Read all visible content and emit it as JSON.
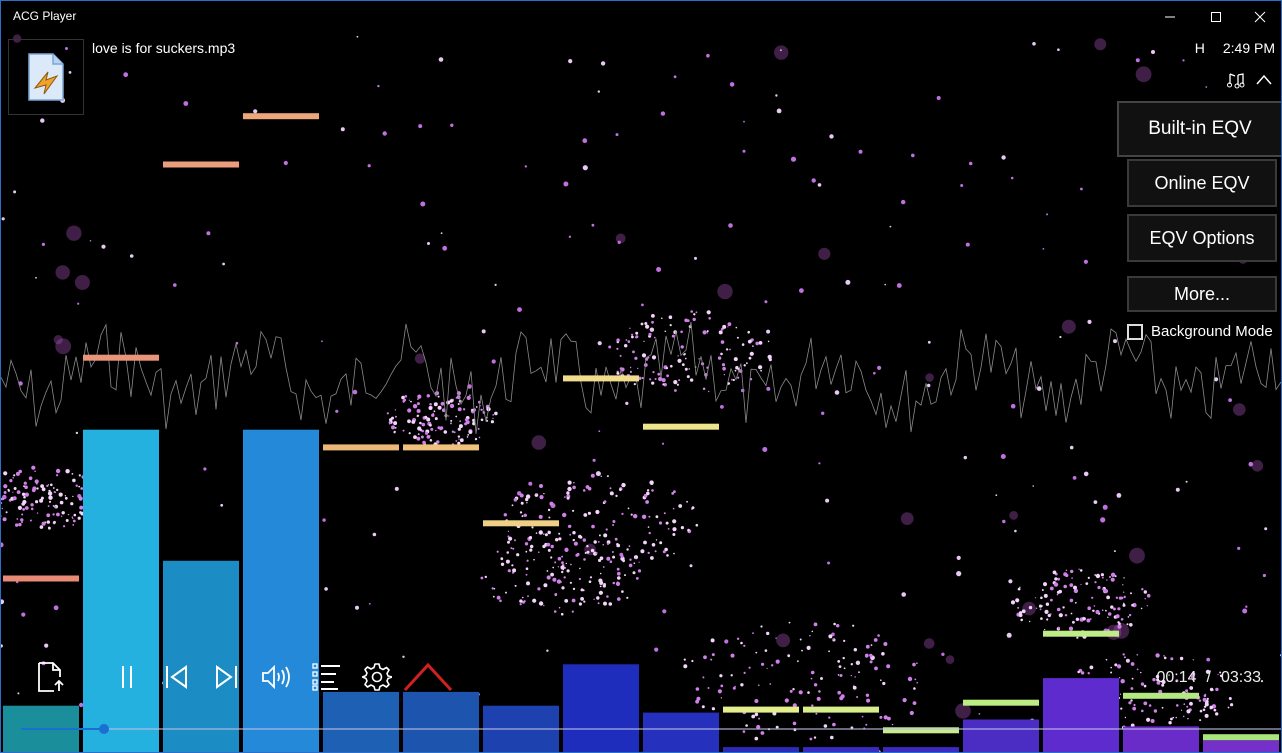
{
  "window": {
    "title": "ACG Player",
    "minimize_label": "Minimize",
    "maximize_label": "Maximize",
    "close_label": "Close"
  },
  "header": {
    "song_title": "love is for suckers.mp3",
    "album_art_icon": "winamp-file-icon",
    "status_indicator": "H",
    "clock": "2:49 PM",
    "music_icon": "music-notes-icon",
    "collapse_icon": "chevron-up-icon"
  },
  "side_panel": {
    "buttons": [
      {
        "label": "Built-in EQV"
      },
      {
        "label": "Online EQV"
      },
      {
        "label": "EQV Options"
      },
      {
        "label": "More..."
      }
    ],
    "background_mode": {
      "label": "Background Mode",
      "checked": false
    }
  },
  "controls": {
    "open_file_icon": "open-file-icon",
    "pause_icon": "pause-icon",
    "previous_icon": "previous-track-icon",
    "next_icon": "next-track-icon",
    "volume_icon": "volume-icon",
    "playlist_icon": "playlist-icon",
    "settings_icon": "gear-icon",
    "expand_icon": "chevron-up-icon"
  },
  "playback": {
    "current_time": "00:14",
    "separator": "/",
    "total_time": "03:33",
    "progress": 0.066
  },
  "visualizer": {
    "bar_levels": [
      0.07,
      0.47,
      0.28,
      0.47,
      0.09,
      0.09,
      0.07,
      0.13,
      0.06,
      0.01,
      0.01,
      0.01,
      0.05,
      0.11,
      0.04,
      0.02
    ],
    "peak_levels": [
      0.25,
      0.57,
      0.85,
      0.92,
      0.44,
      0.44,
      0.33,
      0.54,
      0.47,
      0.06,
      0.06,
      0.03,
      0.07,
      0.17,
      0.08,
      0.02
    ],
    "bar_colors": [
      "#1b8e9c",
      "#25b1e0",
      "#1c8cc4",
      "#2389d8",
      "#1e60b4",
      "#1c54ae",
      "#1d42b0",
      "#1f2dbd",
      "#2530bd",
      "#2d2ab8",
      "#3a2bc0",
      "#3d2ac0",
      "#4b2dc4",
      "#5e2bce",
      "#6a2cc8",
      "#7430c8"
    ],
    "peak_colors": [
      "#e88a74",
      "#e8957a",
      "#ec9d7c",
      "#eca67a",
      "#ecb878",
      "#eec27c",
      "#f0d086",
      "#f0dc8c",
      "#ece58c",
      "#e4ee8c",
      "#d8ee8c",
      "#c8ec88",
      "#bcec84",
      "#c0ec88",
      "#b4e880",
      "#a8e67c"
    ],
    "waveform_color": "#8a8a8a"
  }
}
